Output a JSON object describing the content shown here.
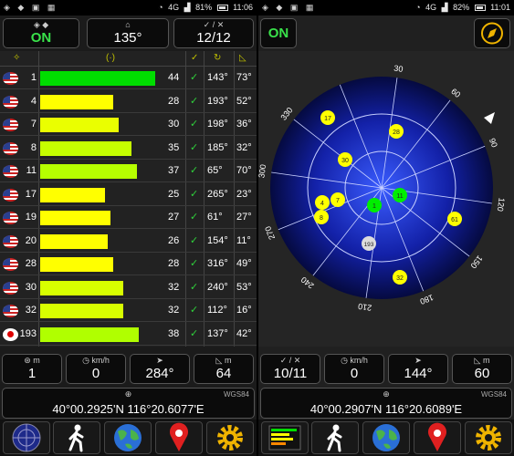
{
  "left": {
    "status": {
      "time": "11:06",
      "battery": "81%",
      "network": "4G"
    },
    "top": [
      {
        "title": "◈ ◆",
        "value": "ON"
      },
      {
        "title": "⌂",
        "value": "135°"
      },
      {
        "title": "✓ / ✕",
        "value": "12/12"
      }
    ],
    "table_header": {
      "sat": "✧",
      "snr": "(·)",
      "chk": "✓",
      "az": "↻",
      "el": "◺"
    },
    "rows": [
      {
        "prn": "1",
        "snr": "44",
        "az": "143°",
        "el": "73°",
        "color": "#00dd00",
        "flag": "us"
      },
      {
        "prn": "4",
        "snr": "28",
        "az": "193°",
        "el": "52°",
        "color": "#ffff00",
        "flag": "us"
      },
      {
        "prn": "7",
        "snr": "30",
        "az": "198°",
        "el": "36°",
        "color": "#eaff00",
        "flag": "us"
      },
      {
        "prn": "8",
        "snr": "35",
        "az": "185°",
        "el": "32°",
        "color": "#c6ff00",
        "flag": "us"
      },
      {
        "prn": "11",
        "snr": "37",
        "az": "65°",
        "el": "70°",
        "color": "#b6ff00",
        "flag": "us"
      },
      {
        "prn": "17",
        "snr": "25",
        "az": "265°",
        "el": "23°",
        "color": "#ffff00",
        "flag": "us"
      },
      {
        "prn": "19",
        "snr": "27",
        "az": "61°",
        "el": "27°",
        "color": "#ffff00",
        "flag": "us"
      },
      {
        "prn": "20",
        "snr": "26",
        "az": "154°",
        "el": "11°",
        "color": "#ffff00",
        "flag": "us"
      },
      {
        "prn": "28",
        "snr": "28",
        "az": "316°",
        "el": "49°",
        "color": "#ffff00",
        "flag": "us"
      },
      {
        "prn": "30",
        "snr": "32",
        "az": "240°",
        "el": "53°",
        "color": "#d8ff00",
        "flag": "us"
      },
      {
        "prn": "32",
        "snr": "32",
        "az": "112°",
        "el": "16°",
        "color": "#d8ff00",
        "flag": "us"
      },
      {
        "prn": "193",
        "snr": "38",
        "az": "137°",
        "el": "42°",
        "color": "#b0ff00",
        "flag": "jp"
      }
    ],
    "bottom": [
      {
        "title": "⊛  m",
        "value": "1"
      },
      {
        "title": "◷  km/h",
        "value": "0"
      },
      {
        "title": "",
        "value": "284°"
      },
      {
        "title": "◺  m",
        "value": "64"
      }
    ],
    "coords": {
      "text": "40°00.2925'N   116°20.6077'E",
      "datum": "WGS84"
    },
    "nav": [
      "radar-icon",
      "walk-icon",
      "globe-icon",
      "map-pin-icon",
      "gear-icon"
    ]
  },
  "right": {
    "status": {
      "time": "11:01",
      "battery": "82%",
      "network": "4G"
    },
    "top_on": "ON",
    "compass_icon": "compass-icon",
    "sky_labels": [
      "300",
      "330",
      "30",
      "60",
      "90",
      "120",
      "150",
      "180",
      "210",
      "240",
      "270"
    ],
    "sky_sats": [
      {
        "prn": "17",
        "color": "#ffff00"
      },
      {
        "prn": "28",
        "color": "#ffff00"
      },
      {
        "prn": "30",
        "color": "#ffff00"
      },
      {
        "prn": "11",
        "color": "#00ee00"
      },
      {
        "prn": "1",
        "color": "#00ee00"
      },
      {
        "prn": "7",
        "color": "#ffff00"
      },
      {
        "prn": "4",
        "color": "#ffff00"
      },
      {
        "prn": "8",
        "color": "#ffff00"
      },
      {
        "prn": "61",
        "color": "#ffff00"
      },
      {
        "prn": "193",
        "color": "#dcdcdc"
      },
      {
        "prn": "32",
        "color": "#ffff00"
      }
    ],
    "bottom": [
      {
        "title": "✓ / ✕",
        "value": "10/11"
      },
      {
        "title": "◷  km/h",
        "value": "0"
      },
      {
        "title": "",
        "value": "144°"
      },
      {
        "title": "◺  m",
        "value": "60"
      }
    ],
    "coords": {
      "text": "40°00.2907'N   116°20.6089'E",
      "datum": "WGS84"
    },
    "nav": [
      "signal-bars-icon",
      "walk-icon",
      "globe-icon",
      "map-pin-icon",
      "gear-icon"
    ]
  }
}
